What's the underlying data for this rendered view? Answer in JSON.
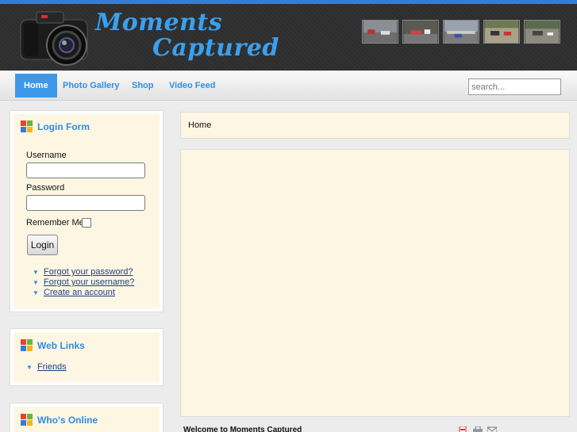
{
  "header": {
    "logo_line1": "Moments",
    "logo_line2": "Captured",
    "thumbnail_icons": [
      "photo-thumbnail",
      "photo-thumbnail",
      "photo-thumbnail",
      "photo-thumbnail",
      "photo-thumbnail"
    ]
  },
  "nav": {
    "items": [
      {
        "label": "Home",
        "active": true
      },
      {
        "label": "Photo Gallery",
        "active": false
      },
      {
        "label": "Shop",
        "active": false
      },
      {
        "label": "Video Feed",
        "active": false
      }
    ],
    "search_placeholder": "search..."
  },
  "login_form": {
    "title": "Login Form",
    "username_label": "Username",
    "username_value": "",
    "password_label": "Password",
    "password_value": "",
    "remember_label": "Remember Me",
    "remember_checked": false,
    "login_button": "Login",
    "links": [
      "Forgot your password?",
      "Forgot your username?",
      "Create an account"
    ]
  },
  "web_links": {
    "title": "Web Links",
    "links": [
      "Friends"
    ]
  },
  "whos_online": {
    "title": "Who's Online"
  },
  "main": {
    "breadcrumb": "Home",
    "article_title": "Welcome to Moments Captured",
    "article_tools": [
      "pdf-icon",
      "print-icon",
      "email-icon"
    ]
  },
  "colors": {
    "accent": "#3d98ea",
    "link": "#1b3f8a",
    "panel": "#fdf6e3",
    "header_bg": "#2d2d2d"
  }
}
